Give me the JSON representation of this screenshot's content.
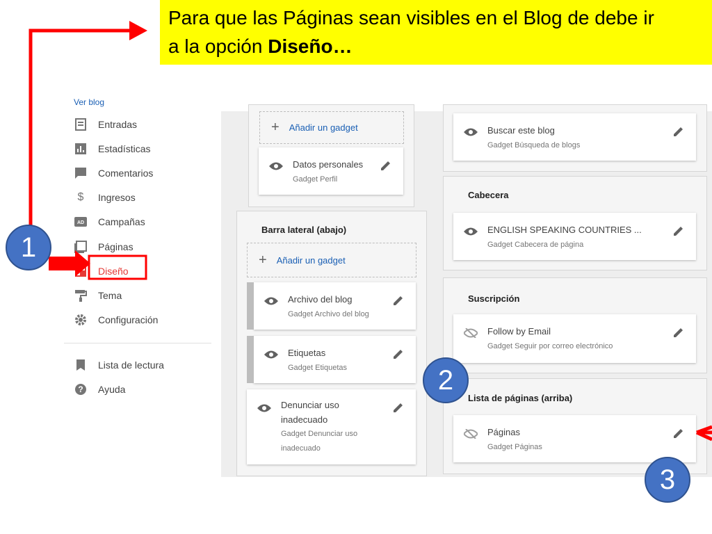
{
  "callout": {
    "line1": "Para que las Páginas sean visibles en el Blog de debe ir",
    "line2_prefix": "a la opción ",
    "line2_bold": "Diseño…"
  },
  "sidebar": {
    "view_blog": "Ver blog",
    "items": [
      {
        "label": "Entradas",
        "icon": "posts-icon"
      },
      {
        "label": "Estadísticas",
        "icon": "stats-icon"
      },
      {
        "label": "Comentarios",
        "icon": "comments-icon"
      },
      {
        "label": "Ingresos",
        "icon": "dollar-icon"
      },
      {
        "label": "Campañas",
        "icon": "ad-icon"
      },
      {
        "label": "Páginas",
        "icon": "pages-icon"
      },
      {
        "label": "Diseño",
        "icon": "layout-icon",
        "active": true
      },
      {
        "label": "Tema",
        "icon": "paint-roller-icon"
      },
      {
        "label": "Configuración",
        "icon": "gear-icon"
      },
      {
        "label": "Lista de lectura",
        "icon": "bookmark-icon"
      },
      {
        "label": "Ayuda",
        "icon": "help-icon"
      }
    ]
  },
  "layout": {
    "add_gadget": "Añadir un gadget",
    "top_left": {
      "gadget": {
        "name": "Datos personales",
        "sub": "Gadget Perfil"
      }
    },
    "sidebar_bottom": {
      "title": "Barra lateral (abajo)",
      "gadgets": [
        {
          "name": "Archivo del blog",
          "sub": "Gadget Archivo del blog"
        },
        {
          "name": "Etiquetas",
          "sub": "Gadget Etiquetas"
        },
        {
          "name_line1": "Denunciar uso",
          "name_line2": "inadecuado",
          "sub_line1": "Gadget Denunciar uso",
          "sub_line2": "inadecuado"
        }
      ]
    },
    "right": {
      "search": {
        "name": "Buscar este blog",
        "sub": "Gadget Búsqueda de blogs"
      },
      "header": {
        "title": "Cabecera",
        "name": "ENGLISH SPEAKING COUNTRIES ...",
        "sub": "Gadget Cabecera de página"
      },
      "subscription": {
        "title": "Suscripción",
        "name": "Follow by Email",
        "sub": "Gadget Seguir por correo electrónico"
      },
      "pages_list": {
        "title": "Lista de páginas (arriba)",
        "name": "Páginas",
        "sub": "Gadget Páginas"
      }
    }
  },
  "annotations": {
    "badge1": "1",
    "badge2": "2",
    "badge3": "3",
    "accent_color": "#ff0000",
    "badge_color": "#4472c4"
  }
}
